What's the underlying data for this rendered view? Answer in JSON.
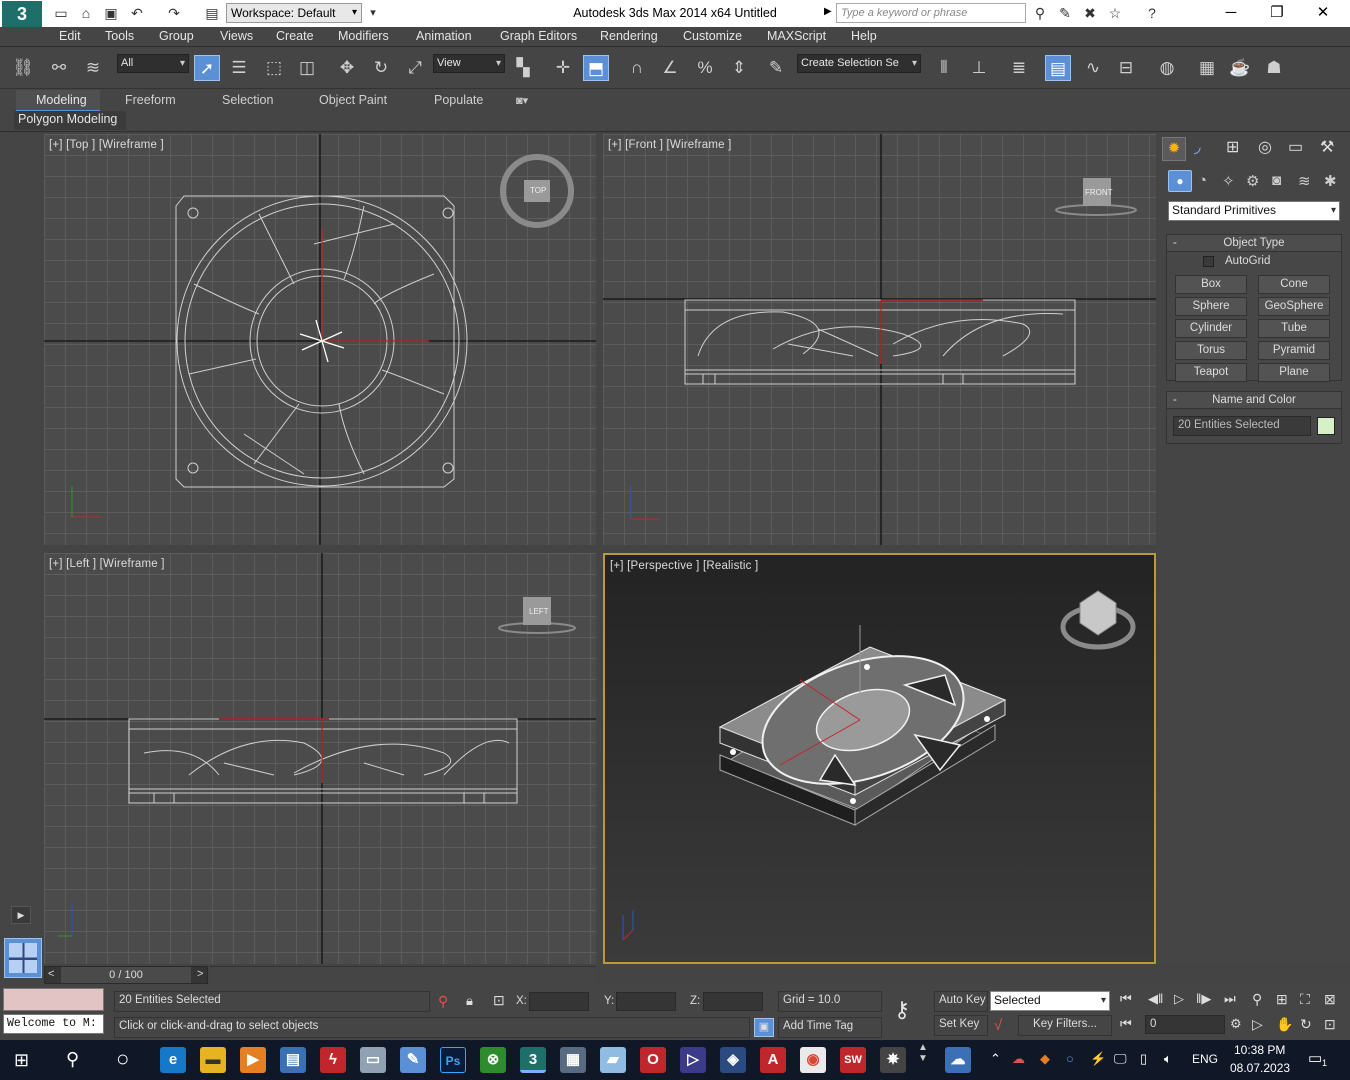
{
  "titlebar": {
    "title": "Autodesk 3ds Max  2014 x64      Untitled",
    "workspace": "Workspace: Default",
    "search_placeholder": "Type a keyword or phrase"
  },
  "menu": [
    "Edit",
    "Tools",
    "Group",
    "Views",
    "Create",
    "Modifiers",
    "Animation",
    "Graph Editors",
    "Rendering",
    "Customize",
    "MAXScript",
    "Help"
  ],
  "toolbar": {
    "filter": "All",
    "ref_coord": "View",
    "selection_set": "Create Selection Se"
  },
  "ribbon": {
    "tabs": [
      "Modeling",
      "Freeform",
      "Selection",
      "Object Paint",
      "Populate"
    ],
    "subtab": "Polygon Modeling"
  },
  "viewports": {
    "top": "[+] [Top ] [Wireframe ]",
    "front": "[+] [Front ] [Wireframe ]",
    "left": "[+] [Left ] [Wireframe ]",
    "perspective": "[+] [Perspective ] [Realistic ]",
    "cube_top": "TOP",
    "cube_front": "FRONT",
    "cube_left": "LEFT"
  },
  "command_panel": {
    "category": "Standard Primitives",
    "object_type_title": "Object Type",
    "autogrid": "AutoGrid",
    "buttons": [
      "Box",
      "Cone",
      "Sphere",
      "GeoSphere",
      "Cylinder",
      "Tube",
      "Torus",
      "Pyramid",
      "Teapot",
      "Plane"
    ],
    "name_color_title": "Name and Color",
    "name_value": "20 Entities Selected",
    "object_color": "#d8f0c8"
  },
  "timeline": {
    "frame": "0 / 100"
  },
  "status": {
    "listener": "Welcome to M:",
    "selection": "20 Entities Selected",
    "prompt": "Click or click-and-drag to select objects",
    "x_label": "X:",
    "y_label": "Y:",
    "z_label": "Z:",
    "grid": "Grid = 10.0",
    "add_time_tag": "Add Time Tag",
    "auto_key": "Auto Key",
    "set_key": "Set Key",
    "key_mode": "Selected",
    "key_filters": "Key Filters...",
    "current_frame": "0"
  },
  "taskbar": {
    "lang": "ENG",
    "time": "10:38 PM",
    "date": "08.07.2023",
    "notif_count": "1"
  }
}
